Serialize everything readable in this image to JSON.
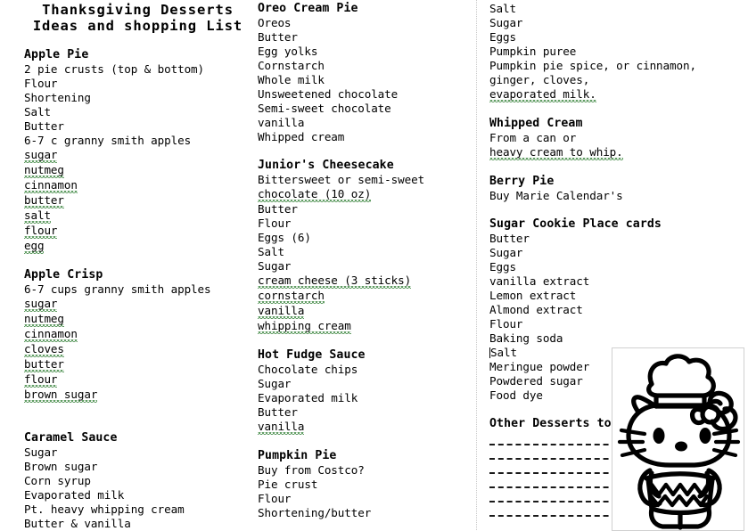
{
  "document": {
    "title_line_1": "Thanksgiving Desserts",
    "title_line_2": "Ideas and shopping List"
  },
  "columns": {
    "left": {
      "sections": [
        {
          "heading": "Apple Pie",
          "items": [
            "2 pie crusts (top & bottom)",
            "Flour",
            "Shortening",
            "Salt",
            "Butter",
            "6-7 c granny smith apples",
            "sugar",
            "nutmeg",
            "cinnamon",
            "butter",
            "salt",
            "flour",
            "egg"
          ]
        },
        {
          "heading": "Apple Crisp",
          "items": [
            "6-7 cups granny smith apples",
            "sugar",
            "nutmeg",
            "cinnamon",
            "cloves",
            "butter",
            "flour",
            "brown sugar"
          ]
        },
        {
          "heading": "Caramel Sauce",
          "items": [
            "Sugar",
            "Brown sugar",
            "Corn syrup",
            "Evaporated milk",
            "Pt. heavy whipping cream",
            "Butter & vanilla"
          ]
        }
      ]
    },
    "middle": {
      "sections": [
        {
          "heading": "Oreo Cream Pie",
          "items": [
            "Oreos",
            "Butter",
            "Egg yolks",
            "Cornstarch",
            "Whole milk",
            "Unsweetened chocolate",
            "Semi-sweet chocolate",
            "vanilla",
            "Whipped cream"
          ]
        },
        {
          "heading": "Junior's Cheesecake",
          "items": [
            "Bittersweet or semi-sweet",
            "chocolate (10 oz)",
            "Butter",
            "Flour",
            "Eggs (6)",
            "Salt",
            "Sugar",
            "cream cheese (3 sticks)",
            "cornstarch",
            "vanilla",
            "whipping cream"
          ]
        },
        {
          "heading": "Hot Fudge Sauce",
          "items": [
            "Chocolate chips",
            "Sugar",
            "Evaporated milk",
            "Butter",
            "vanilla"
          ]
        },
        {
          "heading": "Pumpkin Pie",
          "items": [
            "Buy from Costco?",
            "Pie crust",
            "Flour",
            "Shortening/butter"
          ]
        }
      ]
    },
    "right": {
      "pumpkin_pie_continued": [
        "Salt",
        "Sugar",
        "Eggs",
        "Pumpkin puree",
        "Pumpkin pie spice, or cinnamon,",
        "ginger, cloves,",
        "evaporated milk."
      ],
      "sections": [
        {
          "heading": "Whipped Cream",
          "items": [
            "From a can or",
            "heavy cream to whip."
          ]
        },
        {
          "heading": "Berry Pie",
          "items": [
            "Buy Marie Calendar's"
          ]
        },
        {
          "heading": "Sugar Cookie Place cards",
          "items": [
            "Butter",
            "Sugar",
            "Eggs",
            "vanilla extract",
            "Lemon extract",
            "Almond extract",
            "Flour",
            "Baking soda",
            "Salt",
            "Meringue powder",
            "Powdered sugar",
            "Food dye"
          ]
        }
      ],
      "other_desserts": {
        "heading": "Other Desserts to try",
        "blank_line_count": 6
      }
    }
  },
  "illustration": {
    "name": "hello-kitty-chef-illustration",
    "description": "Hello Kitty line art wearing a chef hat and holding a cake"
  },
  "colors": {
    "text": "#000000",
    "spellcheck_underline": "#2e7d32",
    "page_background": "#ffffff"
  }
}
